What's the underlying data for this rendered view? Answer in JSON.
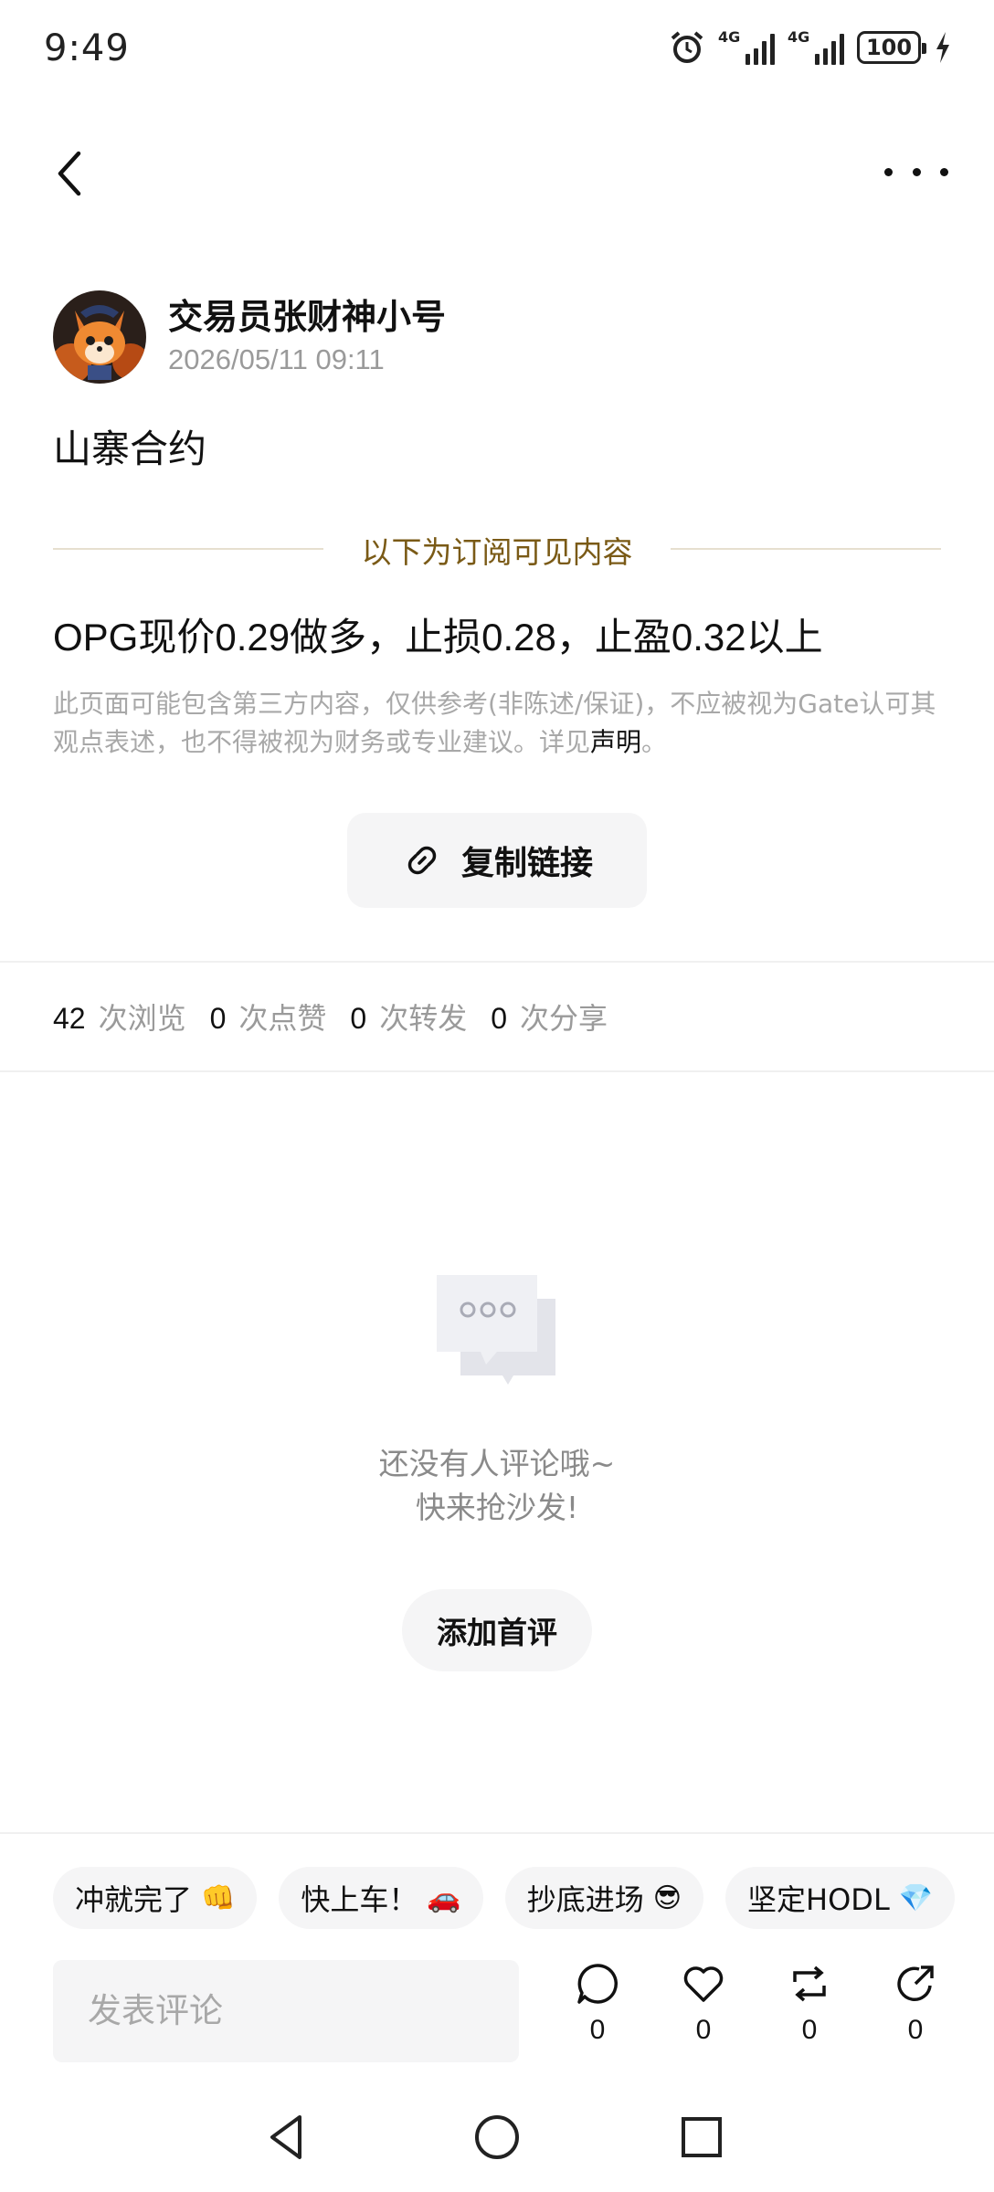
{
  "status_bar": {
    "time": "9:49",
    "network1": "4G",
    "network2": "4G",
    "battery": "100"
  },
  "post": {
    "author": "交易员张财神小号",
    "datetime": "2026/05/11 09:11",
    "title": "山寨合约",
    "subscriber_divider": "以下为订阅可见内容",
    "content": "OPG现价0.29做多，止损0.28，止盈0.32以上",
    "disclaimer": "此页面可能包含第三方内容，仅供参考(非陈述/保证)，不应被视为Gate认可其观点表述，也不得被视为财务或专业建议。详见",
    "disclaimer_link": "声明",
    "disclaimer_end": "。"
  },
  "copy_link_label": "复制链接",
  "stats": {
    "views": "42",
    "views_label": "次浏览",
    "likes": "0",
    "likes_label": "次点赞",
    "reposts": "0",
    "reposts_label": "次转发",
    "shares": "0",
    "shares_label": "次分享"
  },
  "empty_state": {
    "line1": "还没有人评论哦~",
    "line2": "快来抢沙发!",
    "button": "添加首评"
  },
  "quick_replies": [
    {
      "text": "冲就完了",
      "emoji": "👊"
    },
    {
      "text": "快上车！",
      "emoji": "🚗"
    },
    {
      "text": "抄底进场",
      "emoji": "😎"
    },
    {
      "text": "坚定HODL",
      "emoji": "💎"
    }
  ],
  "comment_box": {
    "placeholder": "发表评论"
  },
  "action_counts": {
    "comment": "0",
    "like": "0",
    "repost": "0",
    "share": "0"
  },
  "colors": {
    "gold_text": "#7a5a16",
    "muted": "#9a9a9a",
    "chip_bg": "#f5f5f6"
  }
}
